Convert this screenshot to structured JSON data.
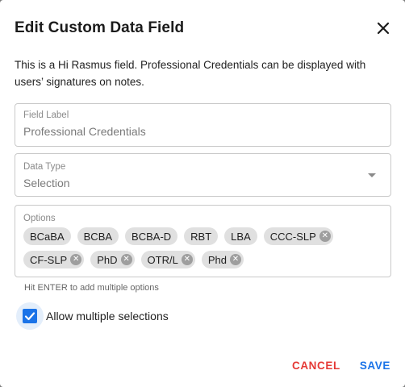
{
  "dialog": {
    "title": "Edit Custom Data Field",
    "description": "This is a Hi Rasmus field. Professional Credentials can be displayed with users’ signatures on notes."
  },
  "field_label": {
    "label": "Field Label",
    "value": "Professional Credentials"
  },
  "data_type": {
    "label": "Data Type",
    "value": "Selection"
  },
  "options": {
    "label": "Options",
    "chips": [
      {
        "text": "BCaBA",
        "deletable": false
      },
      {
        "text": "BCBA",
        "deletable": false
      },
      {
        "text": "BCBA-D",
        "deletable": false
      },
      {
        "text": "RBT",
        "deletable": false
      },
      {
        "text": "LBA",
        "deletable": false
      },
      {
        "text": "CCC-SLP",
        "deletable": true
      },
      {
        "text": "CF-SLP",
        "deletable": true
      },
      {
        "text": "PhD",
        "deletable": true
      },
      {
        "text": "OTR/L",
        "deletable": true
      },
      {
        "text": "Phd",
        "deletable": true
      }
    ],
    "helper": "Hit ENTER to add multiple options"
  },
  "allow_multiple": {
    "label": "Allow multiple selections",
    "checked": true
  },
  "actions": {
    "cancel": "CANCEL",
    "save": "SAVE"
  },
  "colors": {
    "accent": "#1a73e8",
    "danger": "#e53935",
    "chip_bg": "#e0e0e0"
  }
}
